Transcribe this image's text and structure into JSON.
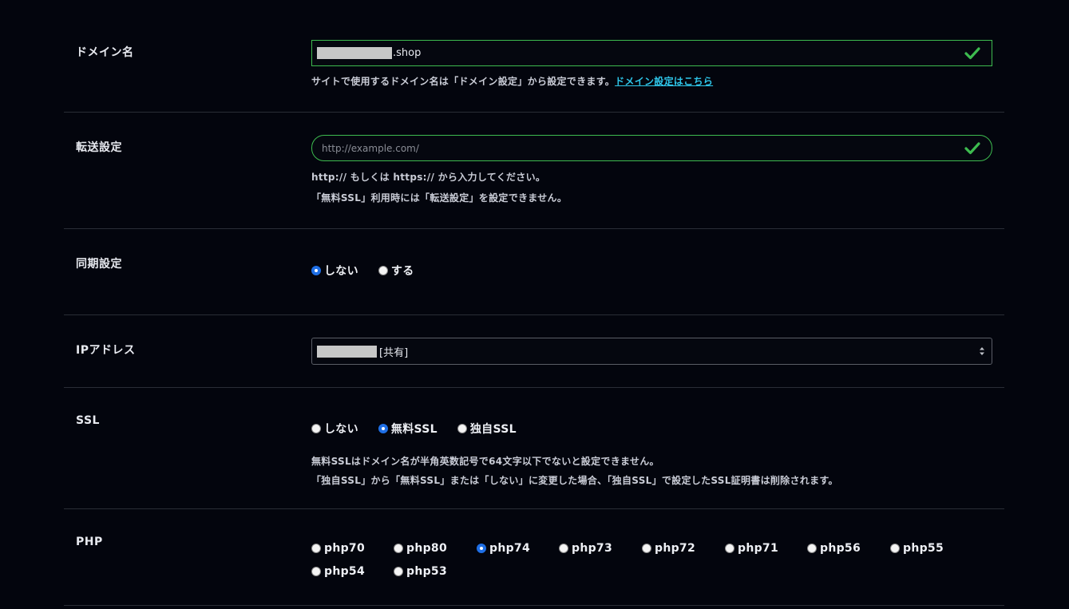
{
  "domain": {
    "label": "ドメイン名",
    "value_suffix": ".shop",
    "help_text": "サイトで使用するドメイン名は「ドメイン設定」から設定できます。",
    "help_link": "ドメイン設定はこちら"
  },
  "redirect": {
    "label": "転送設定",
    "placeholder": "http://example.com/",
    "help_line1": "http:// もしくは https:// から入力してください。",
    "help_line2": "「無料SSL」利用時には「転送設定」を設定できません。"
  },
  "sync": {
    "label": "同期設定",
    "options": [
      "しない",
      "する"
    ],
    "selected": "しない"
  },
  "ip": {
    "label": "IPアドレス",
    "value_suffix": "[共有]"
  },
  "ssl": {
    "label": "SSL",
    "options": [
      "しない",
      "無料SSL",
      "独自SSL"
    ],
    "selected": "無料SSL",
    "help_line1": "無料SSLはドメイン名が半角英数記号で64文字以下でないと設定できません。",
    "help_line2": "「独自SSL」から「無料SSL」または「しない」に変更した場合、「独自SSL」で設定したSSL証明書は削除されます。"
  },
  "php": {
    "label": "PHP",
    "options": [
      "php70",
      "php80",
      "php74",
      "php73",
      "php72",
      "php71",
      "php56",
      "php55",
      "php54",
      "php53"
    ],
    "selected": "php74"
  },
  "colors": {
    "background": "#03050d",
    "valid_border": "#3dbb4f",
    "link": "#2ec5e8",
    "radio_checked": "#1f6fe5"
  }
}
